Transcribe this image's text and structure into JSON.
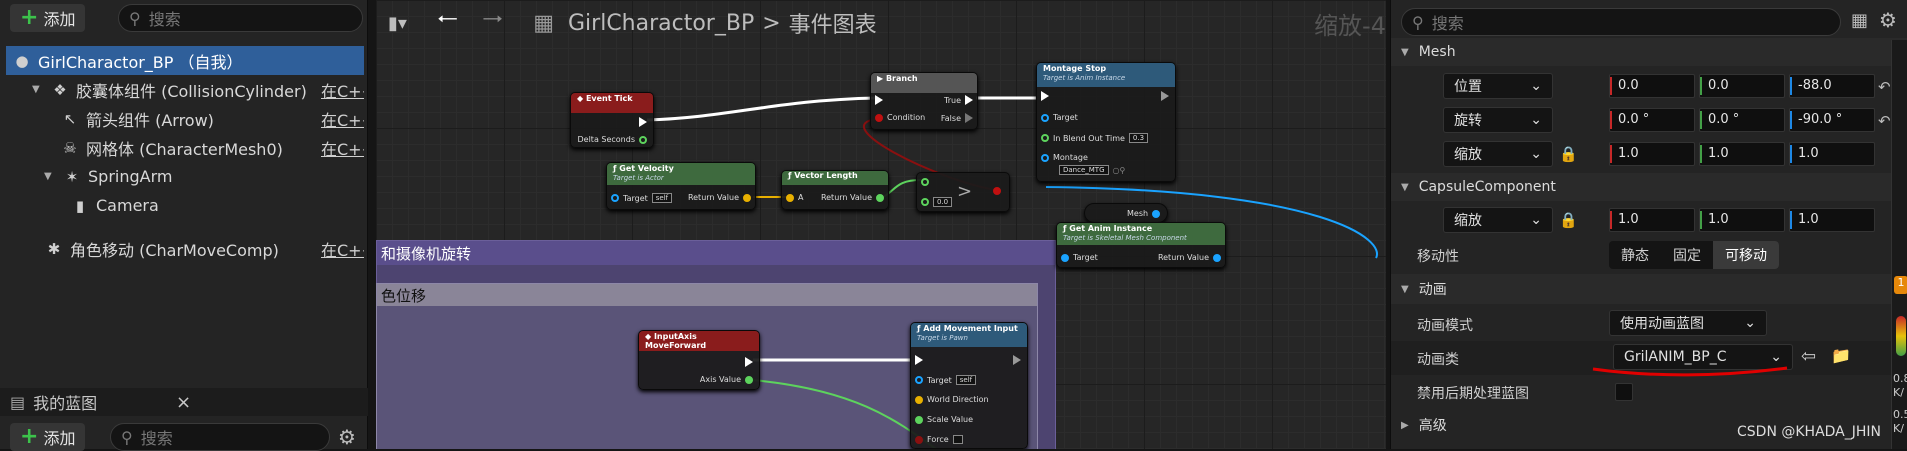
{
  "left": {
    "add_label": "添加",
    "search_placeholder": "搜索",
    "tree": [
      {
        "label": "GirlCharactor_BP （自我）",
        "edit": ""
      },
      {
        "label": "胶囊体组件 (CollisionCylinder)",
        "edit": "在C++"
      },
      {
        "label": "箭头组件 (Arrow)",
        "edit": "在C++中编辑"
      },
      {
        "label": "网格体 (CharacterMesh0)",
        "edit": "在C++中纟"
      },
      {
        "label": "SpringArm",
        "edit": ""
      },
      {
        "label": "Camera",
        "edit": ""
      },
      {
        "label": "角色移动 (CharMoveComp)",
        "edit": "在C++中纟"
      }
    ],
    "blueprints_title": "我的蓝图",
    "close_label": "×",
    "add2_label": "添加",
    "search2_placeholder": "搜索"
  },
  "graph": {
    "breadcrumb_bp": "GirlCharactor_BP",
    "breadcrumb_sep": ">",
    "breadcrumb_graph": "事件图表",
    "zoom": "缩放-4",
    "comment_outer": "和摄像机旋转",
    "comment_inner": "色位移",
    "nodes": {
      "event_tick": {
        "title": "Event Tick",
        "pin": "Delta Seconds"
      },
      "branch": {
        "title": "Branch",
        "condition": "Condition",
        "true": "True",
        "false": "False"
      },
      "montage_stop": {
        "title": "Montage Stop",
        "sub": "Target is Anim Instance",
        "target": "Target",
        "blend": "In Blend Out Time",
        "blend_val": "0.3",
        "montage": "Montage",
        "montage_val": "Dance_MTG"
      },
      "get_velocity": {
        "title": "Get Velocity",
        "sub": "Target is Actor",
        "target": "Target",
        "self": "self",
        "ret": "Return Value"
      },
      "vector_length": {
        "title": "Vector Length",
        "a": "A",
        "ret": "Return Value"
      },
      "greater": {
        "op": ">",
        "val": "0.0"
      },
      "mesh": {
        "label": "Mesh"
      },
      "get_anim_instance": {
        "title": "Get Anim Instance",
        "sub": "Target is Skeletal Mesh Component",
        "target": "Target",
        "ret": "Return Value"
      },
      "input_axis": {
        "title": "InputAxis MoveForward",
        "axis": "Axis Value"
      },
      "add_movement": {
        "title": "Add Movement Input",
        "sub": "Target is Pawn",
        "target": "Target",
        "self": "self",
        "world": "World Direction",
        "scale": "Scale Value",
        "force": "Force"
      }
    }
  },
  "right": {
    "search_placeholder": "搜索",
    "mesh_section": "Mesh",
    "location_label": "位置",
    "location": [
      "0.0",
      "0.0",
      "-88.0"
    ],
    "rotation_label": "旋转",
    "rotation": [
      "0.0 °",
      "0.0 °",
      "-90.0 °"
    ],
    "scale_label": "缩放",
    "scale": [
      "1.0",
      "1.0",
      "1.0"
    ],
    "capsule_section": "CapsuleComponent",
    "capsule_scale_label": "缩放",
    "capsule_scale": [
      "1.0",
      "1.0",
      "1.0"
    ],
    "mobility_label": "移动性",
    "mobility_options": [
      "静态",
      "固定",
      "可移动"
    ],
    "animation_section": "动画",
    "anim_mode_label": "动画模式",
    "anim_mode_value": "使用动画蓝图",
    "anim_class_label": "动画类",
    "anim_class_value": "GrilANIM_BP_C",
    "disable_post_label": "禁用后期处理蓝图",
    "advanced_section": "高级",
    "edge_values": [
      "0.8",
      "K/",
      "0.5",
      "K/"
    ]
  },
  "watermark": "CSDN @KHADA_JHIN",
  "colors": {
    "x": "#c62828",
    "y": "#43a047",
    "z": "#1e88e5",
    "selection": "#2f5f9a",
    "annotation": "#e00000"
  }
}
